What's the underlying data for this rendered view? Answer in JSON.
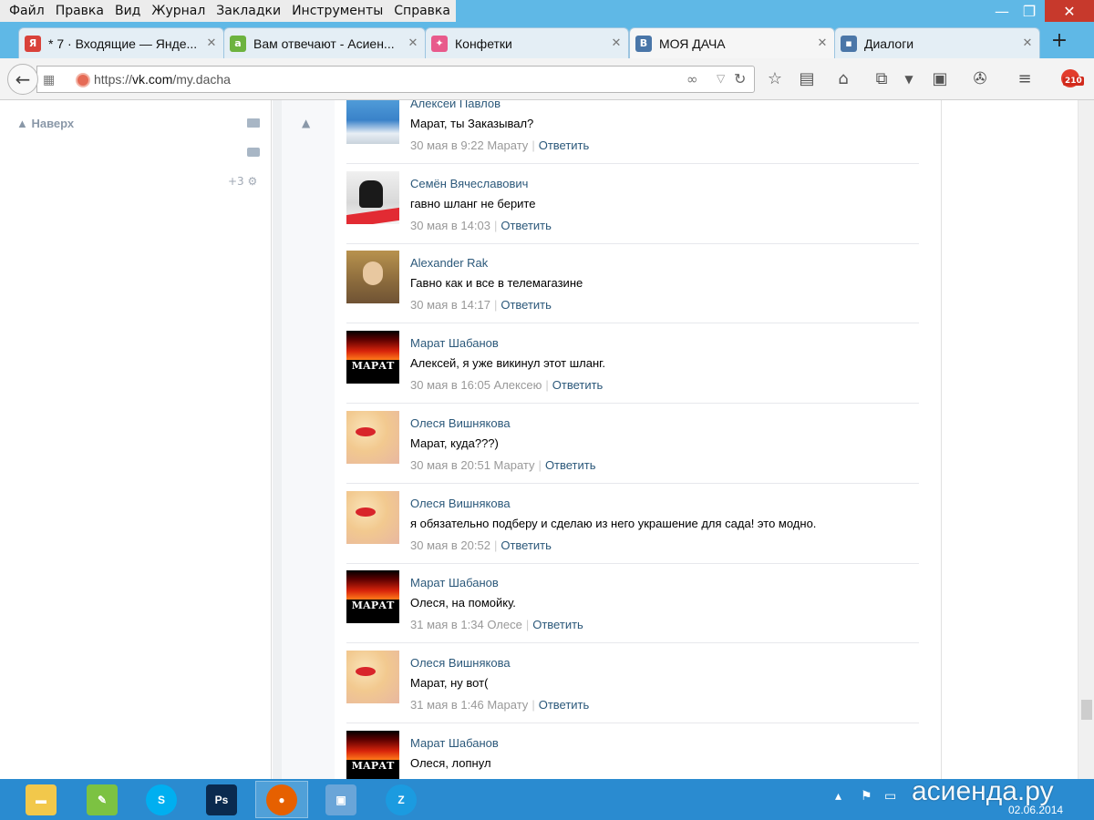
{
  "menu": [
    "Файл",
    "Правка",
    "Вид",
    "Журнал",
    "Закладки",
    "Инструменты",
    "Справка"
  ],
  "window_controls": {
    "minimize": "—",
    "maximize": "❐",
    "close": "✕"
  },
  "tabs": [
    {
      "title": "* 7 · Входящие — Янде...",
      "icon": "yandex-mail-icon",
      "color": "#d9423b",
      "glyph": "Я"
    },
    {
      "title": "Вам отвечают - Асиен...",
      "icon": "asienda-icon",
      "color": "#6db33f",
      "glyph": "a"
    },
    {
      "title": "Конфетки",
      "icon": "candy-icon",
      "color": "#e85a8c",
      "glyph": "✦"
    },
    {
      "title": "МОЯ ДАЧА",
      "icon": "vk-icon",
      "color": "#4a76a8",
      "glyph": "В",
      "active": true
    },
    {
      "title": "Диалоги",
      "icon": "vk-dialogs-icon",
      "color": "#4a76a8",
      "glyph": "▪"
    }
  ],
  "tab_close": "✕",
  "new_tab": "+",
  "address": {
    "prefix": "https://",
    "domain": "vk.com",
    "path": "/my.dacha"
  },
  "toolbar_badge": "210",
  "left": {
    "naverh": "Наверх",
    "plus": "+3"
  },
  "posts": [
    {
      "name": "Алексей Павлов",
      "text": "Марат, ты Заказывал?",
      "meta": "30 мая в 9:22 Марату",
      "reply": "Ответить",
      "avatar": "alexey"
    },
    {
      "name": "Семён Вячеславович",
      "text": "гавно шланг не берите",
      "meta": "30 мая в 14:03",
      "reply": "Ответить",
      "avatar": "semen"
    },
    {
      "name": "Alexander Rak",
      "text": "Гавно как и все в телемагазине",
      "meta": "30 мая в 14:17",
      "reply": "Ответить",
      "avatar": "rak"
    },
    {
      "name": "Марат Шабанов",
      "text": "Алексей, я уже викинул этот шланг.",
      "meta": "30 мая в 16:05 Алексею",
      "reply": "Ответить",
      "avatar": "marat"
    },
    {
      "name": "Олеся Вишнякова",
      "text": "Марат, куда???)",
      "meta": "30 мая в 20:51 Марату",
      "reply": "Ответить",
      "avatar": "olesya"
    },
    {
      "name": "Олеся Вишнякова",
      "text": "я обязательно подберу и сделаю из него украшение для сада! это модно.",
      "meta": "30 мая в 20:52",
      "reply": "Ответить",
      "avatar": "olesya"
    },
    {
      "name": "Марат Шабанов",
      "text": "Олеся, на помойку.",
      "meta": "31 мая в 1:34 Олесе",
      "reply": "Ответить",
      "avatar": "marat"
    },
    {
      "name": "Олеся Вишнякова",
      "text": "Марат, ну вот(",
      "meta": "31 мая в 1:46 Марату",
      "reply": "Ответить",
      "avatar": "olesya"
    },
    {
      "name": "Марат Шабанов",
      "text": "Олеся, лопнул",
      "meta": "",
      "reply": "",
      "avatar": "marat"
    }
  ],
  "marat_avatar_word": "МАРАТ",
  "taskbar": {
    "apps": [
      {
        "name": "file-explorer",
        "color": "#f2c84b",
        "glyph": "▬"
      },
      {
        "name": "notepad-plus",
        "color": "#7cc242",
        "glyph": "✎"
      },
      {
        "name": "skype",
        "color": "#00aff0",
        "glyph": "S"
      },
      {
        "name": "photoshop",
        "color": "#0a2a4f",
        "glyph": "Ps"
      },
      {
        "name": "firefox",
        "color": "#e66000",
        "glyph": "●",
        "active": true
      },
      {
        "name": "image-viewer",
        "color": "#6aa5d8",
        "glyph": "▣"
      },
      {
        "name": "zona",
        "color": "#1b9be0",
        "glyph": "Z"
      }
    ],
    "watermark": "асиенда.ру",
    "date": "02.06.2014"
  }
}
